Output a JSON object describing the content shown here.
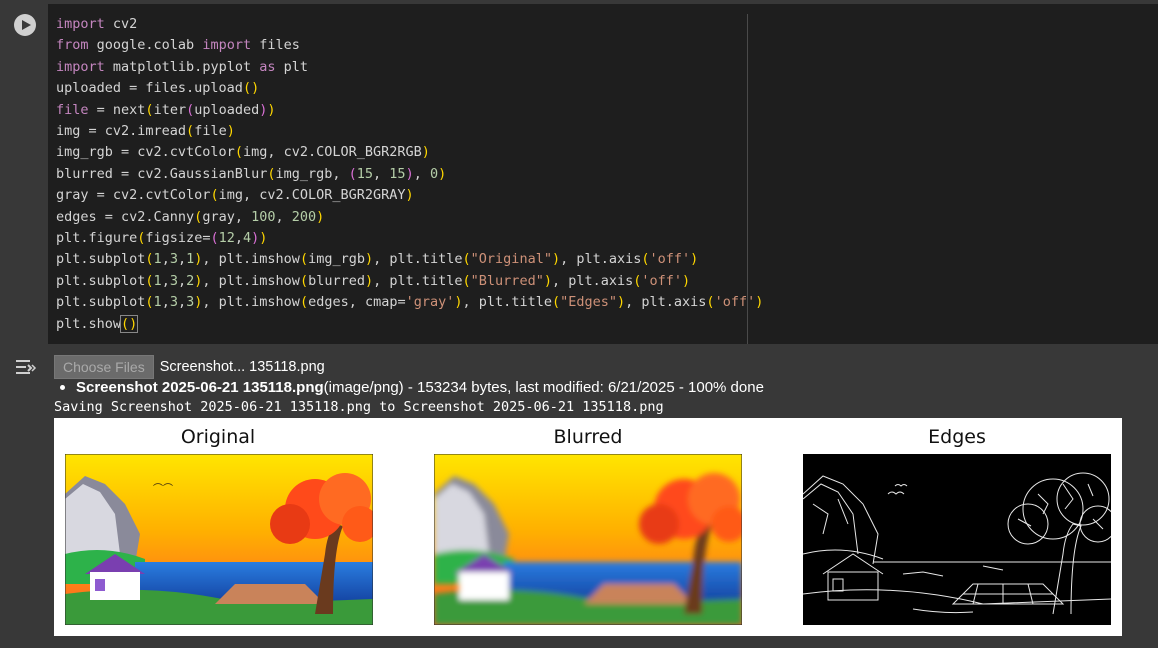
{
  "code_cell": {
    "lines": [
      "import cv2",
      "from google.colab import files",
      "import matplotlib.pyplot as plt",
      "uploaded = files.upload()",
      "file = next(iter(uploaded))",
      "img = cv2.imread(file)",
      "img_rgb = cv2.cvtColor(img, cv2.COLOR_BGR2RGB)",
      "blurred = cv2.GaussianBlur(img_rgb, (15, 15), 0)",
      "gray = cv2.cvtColor(img, cv2.COLOR_BGR2GRAY)",
      "edges = cv2.Canny(gray, 100, 200)",
      "plt.figure(figsize=(12,4))",
      "plt.subplot(1,3,1), plt.imshow(img_rgb), plt.title(\"Original\"), plt.axis('off')",
      "plt.subplot(1,3,2), plt.imshow(blurred), plt.title(\"Blurred\"), plt.axis('off')",
      "plt.subplot(1,3,3), plt.imshow(edges, cmap='gray'), plt.title(\"Edges\"), plt.axis('off')",
      "plt.show()"
    ]
  },
  "output": {
    "choose_files_label": "Choose Files",
    "chosen_file": "Screenshot... 135118.png",
    "file_name": "Screenshot 2025-06-21 135118.png",
    "file_details": "(image/png) - 153234 bytes, last modified: 6/21/2025 - 100% done",
    "saving_line": "Saving Screenshot 2025-06-21 135118.png to Screenshot 2025-06-21 135118.png"
  },
  "figure": {
    "titles": [
      "Original",
      "Blurred",
      "Edges"
    ]
  },
  "icons": {
    "run": "play-circle-icon",
    "output_menu": "output-options-icon"
  },
  "colors": {
    "editor_bg": "#1e1e1e",
    "cell_bg": "#383838",
    "keyword": "#c586c0",
    "string": "#ce9178",
    "number": "#b5cea8"
  }
}
